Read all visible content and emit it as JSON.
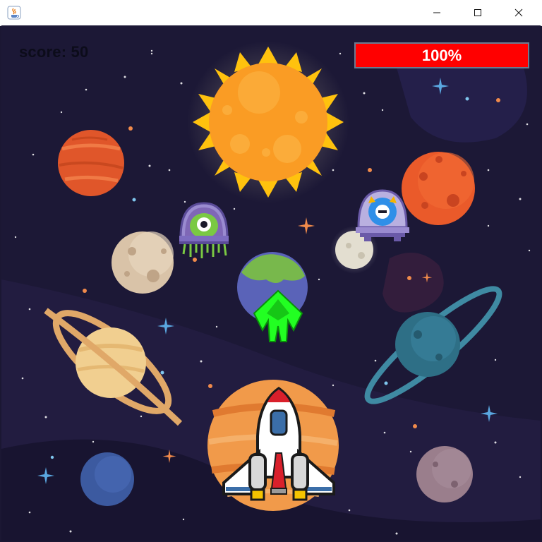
{
  "window": {
    "title": "",
    "controls": {
      "minimize": "minimize-icon",
      "maximize": "maximize-icon",
      "close": "close-icon"
    }
  },
  "hud": {
    "score_text": "score: 50",
    "health": {
      "label": "100%",
      "value": 1.0,
      "fill_color": "#ff0000",
      "border_color": "#6d7a90"
    }
  },
  "game": {
    "background_color": "#1b1733",
    "player": {
      "name": "space-shuttle"
    },
    "enemies": [
      {
        "name": "green-alien-ufo",
        "color": "#7ac943"
      },
      {
        "name": "blue-alien-ufo",
        "color": "#2f8fe8"
      }
    ],
    "projectiles": [
      {
        "name": "green-arrow-shot",
        "color": "#22ff22"
      }
    ]
  }
}
